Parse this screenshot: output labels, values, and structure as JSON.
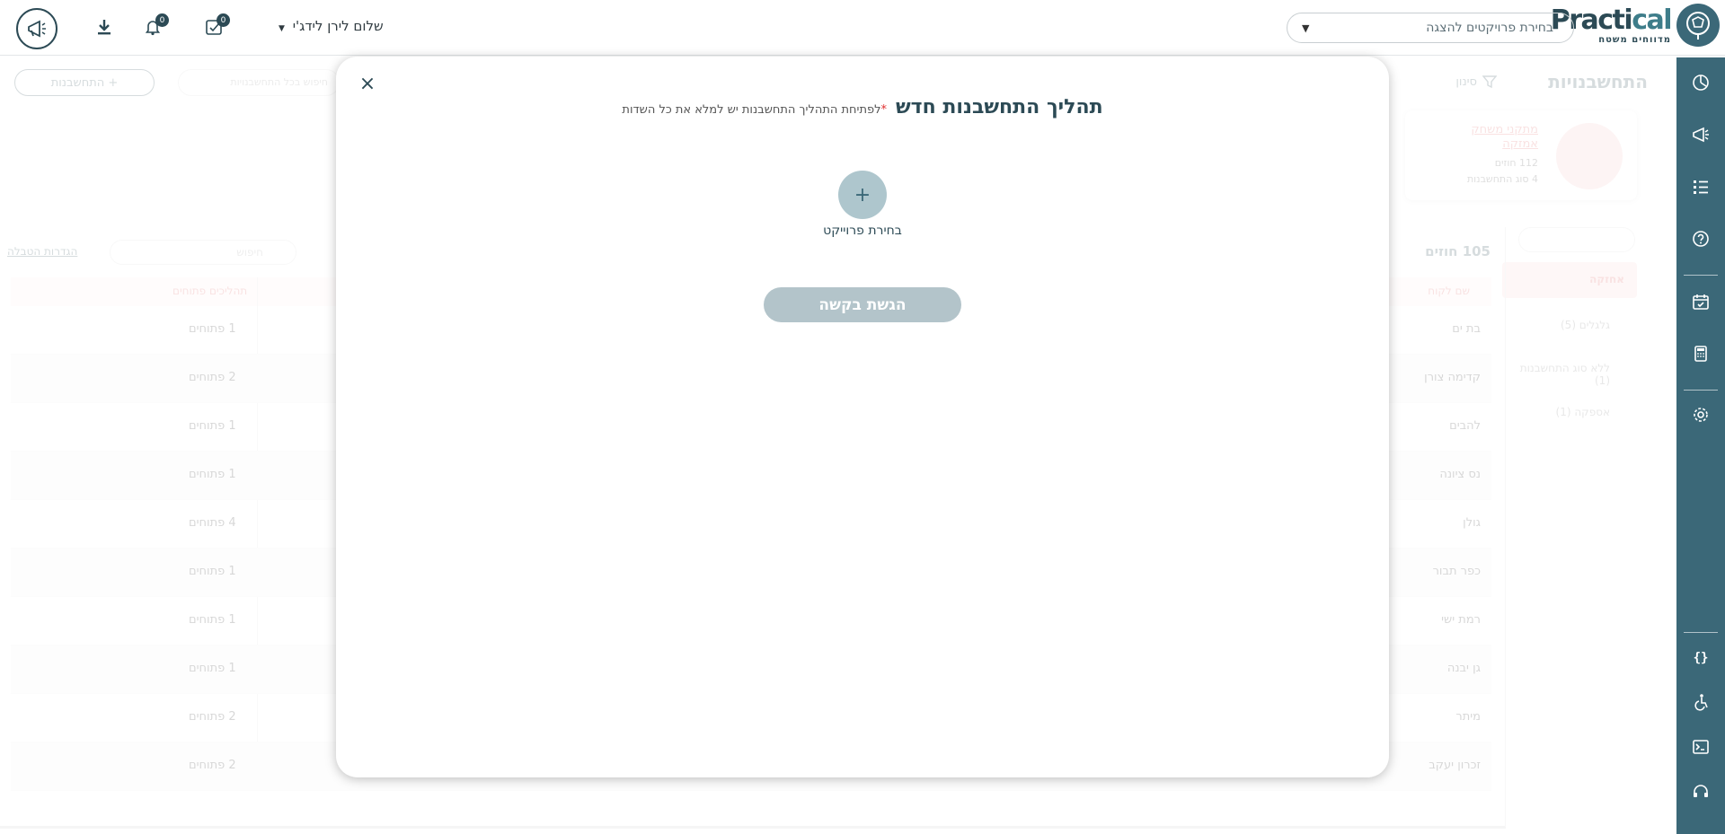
{
  "topbar": {
    "logo_word_a": "Practi",
    "logo_word_b": "cal",
    "logo_sub": "מדווחים  משטח",
    "project_select_placeholder": "בחירת פרויקטים להצגה",
    "greeting": "שלום לירן לידג'י",
    "tasks_badge": "0",
    "notifications_badge": "0"
  },
  "background": {
    "page_title": "התחשבנויות",
    "filter_label": "סינון",
    "add_button": "+ התחשבנות",
    "search_all_placeholder": "חיפוש בכל התחשבנויות",
    "card": {
      "name": "מתקני משחק אמזקה",
      "contracts": "112 חוזים",
      "types": "4 סוג התחשבנות"
    },
    "side_items": [
      {
        "label": "אחזקה",
        "active": true
      },
      {
        "label": "גלגלים (5)"
      },
      {
        "label": "ללא סוג התחשבנות (1)"
      },
      {
        "label": "אספקה (1)"
      }
    ],
    "contracts_count": "105 חוזים",
    "table_search_placeholder": "חיפוש",
    "settings_link": "הגדרות הטבלה",
    "columns": {
      "customer": "שם לקוח",
      "open_processes": "תהליכים פתוחים"
    },
    "rows": [
      {
        "customer": "בת ים",
        "open": "1 פתוחים"
      },
      {
        "customer": "קדימה צורן",
        "open": "2 פתוחים"
      },
      {
        "customer": "להבים",
        "open": "1 פתוחים"
      },
      {
        "customer": "נס ציונה",
        "open": "1 פתוחים"
      },
      {
        "customer": "גולן",
        "open": "4 פתוחים"
      },
      {
        "customer": "כפר תבור",
        "open": "1 פתוחים"
      },
      {
        "customer": "רמת ישי",
        "open": "1 פתוחים"
      },
      {
        "customer": "גן יבנה",
        "open": "1 פתוחים"
      },
      {
        "customer": "מיתר",
        "open": "2 פתוחים"
      },
      {
        "customer": "זכרון יעקב",
        "open": "2 פתוחים"
      }
    ]
  },
  "modal": {
    "title": "תהליך התחשבנות חדש",
    "required_star": "*",
    "required_note": "לפתיחת התהליך התחשבנות יש למלא את כל השדות",
    "project_button_icon": "+",
    "project_label": "בחירת פרוייקט",
    "submit_label": "הגשת בקשה",
    "close_icon": "×"
  },
  "colors": {
    "brand": "#3b6878",
    "brand_dark": "#2c4a55",
    "accent_pink": "#e06b6b",
    "submit_disabled": "#b3c4ca",
    "project_circle": "#aec6cd"
  },
  "icons": {
    "sidenav": [
      "dashboard-icon",
      "megaphone-icon",
      "list-icon",
      "help-icon",
      "calendar-check-icon",
      "calculator-icon",
      "settings-icon",
      "code-icon",
      "accessibility-icon",
      "terminal-icon",
      "headset-icon"
    ],
    "topbar": [
      "download-icon",
      "bell-icon",
      "task-check-icon",
      "megaphone-icon"
    ]
  }
}
